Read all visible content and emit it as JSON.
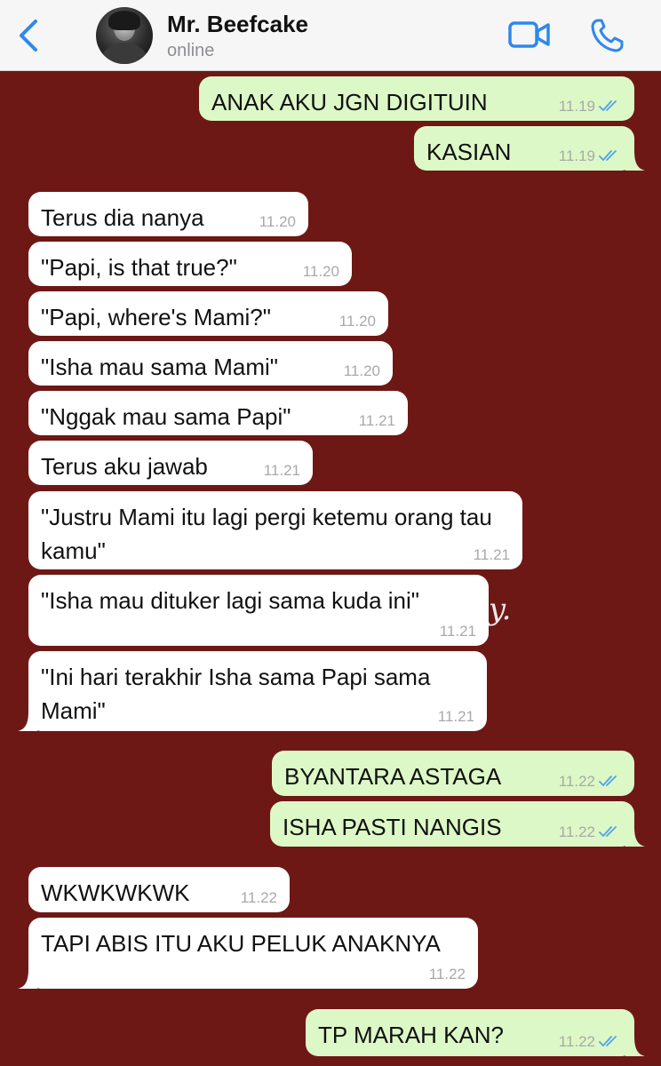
{
  "header": {
    "contact_name": "Mr. Beefcake",
    "status": "online",
    "back_icon": "chevron-left-icon",
    "video_icon": "video-camera-icon",
    "call_icon": "phone-icon"
  },
  "watermark": "hy.",
  "colors": {
    "chat_background": "#6e1816",
    "incoming_bubble": "#ffffff",
    "outgoing_bubble": "#dcf8c6",
    "ios_blue": "#2f88ea",
    "read_tick": "#4fa3e8"
  },
  "messages": [
    {
      "dir": "out",
      "text": "ANAK AKU JGN DIGITUIN",
      "time": "11.19",
      "read": true
    },
    {
      "dir": "out",
      "text": "KASIAN",
      "time": "11.19",
      "read": true
    },
    {
      "dir": "in",
      "text": "Terus dia nanya",
      "time": "11.20"
    },
    {
      "dir": "in",
      "text": "\"Papi, is that true?\"",
      "time": "11.20"
    },
    {
      "dir": "in",
      "text": "\"Papi, where's Mami?\"",
      "time": "11.20"
    },
    {
      "dir": "in",
      "text": "\"Isha mau sama Mami\"",
      "time": "11.20"
    },
    {
      "dir": "in",
      "text": "\"Nggak mau sama Papi\"",
      "time": "11.21"
    },
    {
      "dir": "in",
      "text": "Terus aku jawab",
      "time": "11.21"
    },
    {
      "dir": "in",
      "text": "\"Justru Mami itu lagi pergi ketemu orang tau kamu\"",
      "time": "11.21"
    },
    {
      "dir": "in",
      "text": "\"Isha mau dituker lagi sama kuda ini\"",
      "time": "11.21"
    },
    {
      "dir": "in",
      "text": "\"Ini hari terakhir Isha sama Papi sama Mami\"",
      "time": "11.21"
    },
    {
      "dir": "out",
      "text": "BYANTARA ASTAGA",
      "time": "11.22",
      "read": true
    },
    {
      "dir": "out",
      "text": "ISHA PASTI NANGIS",
      "time": "11.22",
      "read": true
    },
    {
      "dir": "in",
      "text": "WKWKWKWK",
      "time": "11.22"
    },
    {
      "dir": "in",
      "text": "TAPI ABIS ITU AKU PELUK ANAKNYA",
      "time": "11.22"
    },
    {
      "dir": "out",
      "text": "TP MARAH KAN?",
      "time": "11.22",
      "read": true
    }
  ]
}
